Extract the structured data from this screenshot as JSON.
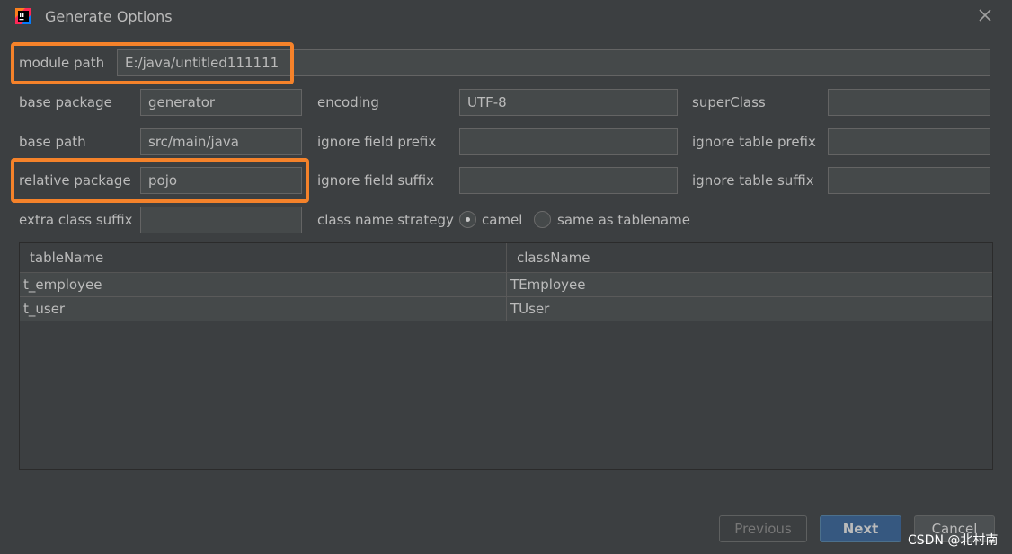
{
  "window": {
    "title": "Generate Options"
  },
  "fields": {
    "module_path": {
      "label": "module path",
      "value": "E:/java/untitled111111"
    },
    "base_package": {
      "label": "base package",
      "value": "generator"
    },
    "encoding": {
      "label": "encoding",
      "value": "UTF-8"
    },
    "super_class": {
      "label": "superClass",
      "value": ""
    },
    "base_path": {
      "label": "base path",
      "value": "src/main/java"
    },
    "ignore_field_prefix": {
      "label": "ignore field prefix",
      "value": ""
    },
    "ignore_table_prefix": {
      "label": "ignore table prefix",
      "value": ""
    },
    "relative_package": {
      "label": "relative package",
      "value": "pojo"
    },
    "ignore_field_suffix": {
      "label": "ignore field suffix",
      "value": ""
    },
    "ignore_table_suffix": {
      "label": "ignore table suffix",
      "value": ""
    },
    "extra_class_suffix": {
      "label": "extra class suffix",
      "value": ""
    }
  },
  "class_name_strategy": {
    "label": "class name strategy",
    "options": [
      {
        "label": "camel",
        "selected": true
      },
      {
        "label": "same as tablename",
        "selected": false
      }
    ]
  },
  "table": {
    "columns": [
      "tableName",
      "className"
    ],
    "rows": [
      [
        "t_employee",
        "TEmployee"
      ],
      [
        "t_user",
        "TUser"
      ]
    ]
  },
  "buttons": {
    "previous": "Previous",
    "next": "Next",
    "cancel": "Cancel"
  },
  "watermark": "CSDN @北村南",
  "colors": {
    "highlight": "#f5822a",
    "primary_button": "#365880",
    "background": "#3c3f41"
  }
}
